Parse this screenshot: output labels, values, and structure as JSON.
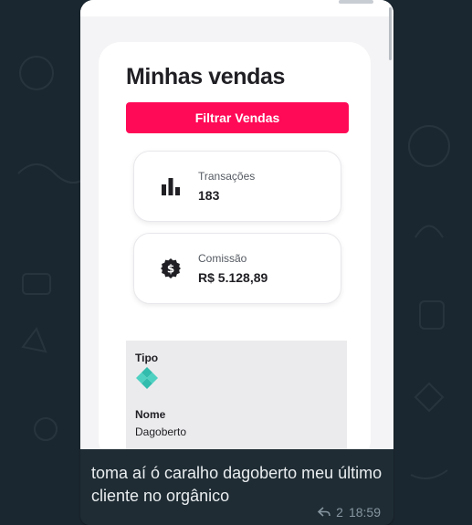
{
  "app": {
    "title": "Minhas vendas",
    "filter_button": "Filtrar Vendas",
    "stats": [
      {
        "label": "Transações",
        "value": "183",
        "icon": "bar-chart-icon"
      },
      {
        "label": "Comissão",
        "value": "R$ 5.128,89",
        "icon": "dollar-coin-icon"
      }
    ],
    "detail": {
      "type_label": "Tipo",
      "type_icon": "pix-diamond-icon",
      "name_label": "Nome",
      "name_value": "Dagoberto"
    },
    "colors": {
      "accent": "#ff0a57",
      "pix": "#32bcad"
    }
  },
  "message": {
    "caption": "toma aí ó caralho dagoberto meu último cliente no orgânico",
    "replies": "2",
    "time": "18:59"
  }
}
